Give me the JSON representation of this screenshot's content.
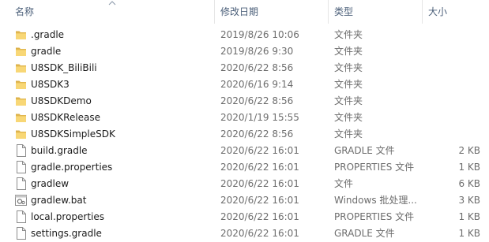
{
  "columns": {
    "name": "名称",
    "date": "修改日期",
    "type": "类型",
    "size": "大小"
  },
  "files": [
    {
      "name": ".gradle",
      "date": "2019/8/26 10:06",
      "type": "文件夹",
      "size": "",
      "icon": "folder-icon"
    },
    {
      "name": "gradle",
      "date": "2019/8/26 9:30",
      "type": "文件夹",
      "size": "",
      "icon": "folder-icon"
    },
    {
      "name": "U8SDK_BiliBili",
      "date": "2020/6/22 8:56",
      "type": "文件夹",
      "size": "",
      "icon": "folder-icon"
    },
    {
      "name": "U8SDK3",
      "date": "2020/6/16 9:14",
      "type": "文件夹",
      "size": "",
      "icon": "folder-icon"
    },
    {
      "name": "U8SDKDemo",
      "date": "2020/6/22 8:56",
      "type": "文件夹",
      "size": "",
      "icon": "folder-icon"
    },
    {
      "name": "U8SDKRelease",
      "date": "2020/1/19 15:55",
      "type": "文件夹",
      "size": "",
      "icon": "folder-icon"
    },
    {
      "name": "U8SDKSimpleSDK",
      "date": "2020/6/22 8:56",
      "type": "文件夹",
      "size": "",
      "icon": "folder-icon"
    },
    {
      "name": "build.gradle",
      "date": "2020/6/22 16:01",
      "type": "GRADLE 文件",
      "size": "2 KB",
      "icon": "file-icon"
    },
    {
      "name": "gradle.properties",
      "date": "2020/6/22 16:01",
      "type": "PROPERTIES 文件",
      "size": "1 KB",
      "icon": "file-icon"
    },
    {
      "name": "gradlew",
      "date": "2020/6/22 16:01",
      "type": "文件",
      "size": "6 KB",
      "icon": "file-icon"
    },
    {
      "name": "gradlew.bat",
      "date": "2020/6/22 16:01",
      "type": "Windows 批处理...",
      "size": "3 KB",
      "icon": "batch-file-icon"
    },
    {
      "name": "local.properties",
      "date": "2020/6/22 16:01",
      "type": "PROPERTIES 文件",
      "size": "1 KB",
      "icon": "file-icon"
    },
    {
      "name": "settings.gradle",
      "date": "2020/6/22 16:01",
      "type": "GRADLE 文件",
      "size": "1 KB",
      "icon": "file-icon"
    }
  ]
}
